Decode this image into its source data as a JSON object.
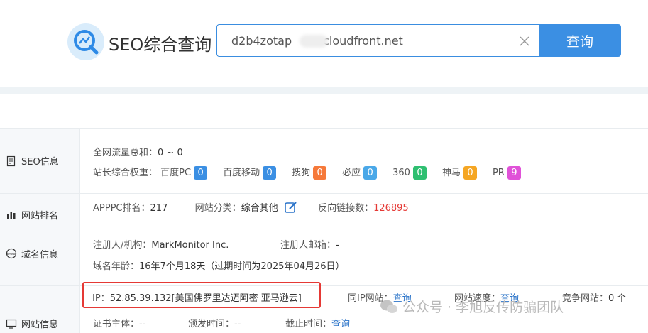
{
  "header": {
    "title": "SEO综合查询",
    "search_value": "d2b4zotap",
    "search_value_suffix": "cloudfront.net",
    "search_button": "查询",
    "icons": {
      "logo": "chart-magnifier-icon",
      "clear": "close-icon"
    }
  },
  "sections": [
    {
      "label": "SEO信息",
      "icon": "document-icon"
    },
    {
      "label": "网站排名",
      "icon": "bar-chart-icon"
    },
    {
      "label": "域名信息",
      "icon": "www-globe-icon"
    },
    {
      "label": "网站信息",
      "icon": "monitor-icon"
    }
  ],
  "seo": {
    "traffic_label": "全网流量总和：",
    "traffic_value": "0 ~ 0",
    "weight_label": "站长综合权重：",
    "weights": [
      {
        "name": "百度PC",
        "value": "0",
        "color": "#3b8fe3"
      },
      {
        "name": "百度移动",
        "value": "0",
        "color": "#3b8fe3"
      },
      {
        "name": "搜狗",
        "value": "0",
        "color": "#f6793a"
      },
      {
        "name": "必应",
        "value": "0",
        "color": "#4aa8e8"
      },
      {
        "name": "360",
        "value": "0",
        "color": "#2fbf71"
      },
      {
        "name": "神马",
        "value": "0",
        "color": "#f5a623"
      },
      {
        "name": "PR",
        "value": "9",
        "color": "#e052d8"
      }
    ]
  },
  "rank": {
    "apppc_label": "APPPC排名：",
    "apppc_value": "217",
    "category_label": "网站分类：",
    "category_value": "综合其他",
    "backlinks_label": "反向链接数：",
    "backlinks_value": "126895"
  },
  "domain": {
    "registrant_label": "注册人/机构：",
    "registrant_value": "MarkMonitor Inc.",
    "email_label": "注册人邮箱：",
    "email_value": "-",
    "age_label": "域名年龄：",
    "age_value": "16年7个月18天（过期时间为2025年04月26日）"
  },
  "site": {
    "ip_label": "IP：",
    "ip_value": "52.85.39.132[美国佛罗里达迈阿密 亚马逊云]",
    "same_ip_label": "同IP网站：",
    "same_ip_link": "查询",
    "speed_label": "网站速度：",
    "speed_link": "查询",
    "compete_label": "竞争网站：",
    "compete_value": "0 个",
    "cert_label": "证书主体：",
    "cert_value": "--",
    "issue_label": "颁发时间：",
    "issue_value": "--",
    "expire_label": "截止时间：",
    "expire_link": "查询"
  },
  "watermark": "公众号 · 李旭反传防骗团队"
}
